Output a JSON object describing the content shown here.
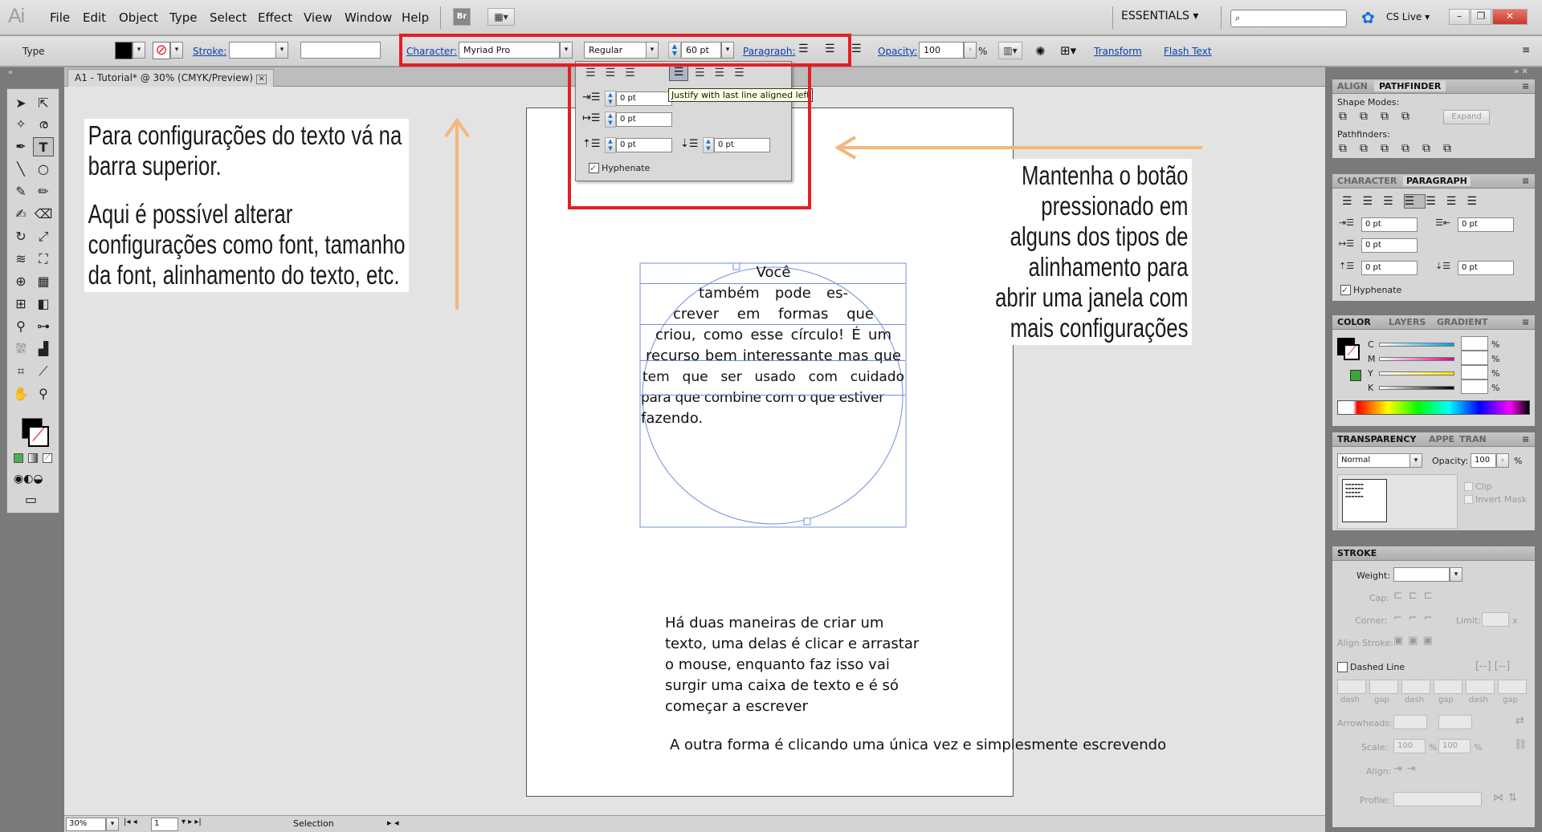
{
  "app": {
    "logo": "Ai",
    "workspace": "ESSENTIALS",
    "cslive": "CS Live",
    "bridge": "Br"
  },
  "menu": [
    "File",
    "Edit",
    "Object",
    "Type",
    "Select",
    "Effect",
    "View",
    "Window",
    "Help"
  ],
  "control": {
    "tool_label": "Type",
    "stroke_label": "Stroke:",
    "character_label": "Character:",
    "font_family": "Myriad Pro",
    "font_style": "Regular",
    "font_size": "60 pt",
    "paragraph_label": "Paragraph:",
    "opacity_label": "Opacity:",
    "opacity_value": "100",
    "opacity_unit": "%",
    "transform_label": "Transform",
    "flash_text_label": "Flash Text"
  },
  "doc_tab": "A1 - Tutorial* @ 30% (CMYK/Preview)",
  "popup": {
    "tooltip": "Justify with last line aligned left",
    "indent_left": "0 pt",
    "indent_first": "0 pt",
    "space_before": "0 pt",
    "space_after": "0 pt",
    "hyphenate": "Hyphenate"
  },
  "annotations": {
    "left_1": "Para configurações do texto vá na",
    "left_2": "barra superior.",
    "left_3": "Aqui é possível alterar",
    "left_4": "configurações como font, tamanho",
    "left_5": "da font, alinhamento do texto, etc.",
    "right_1": "Mantenha o botão",
    "right_2": "pressionado em",
    "right_3": "alguns dos tipos de",
    "right_4": "alinhamento para",
    "right_5": "abrir uma janela com",
    "right_6": "mais configurações"
  },
  "artboard": {
    "circle_lines": [
      "Você",
      "também pode es-",
      "crever em formas que",
      "criou, como esse círculo! É um",
      "recurso bem interessante mas que",
      "tem que ser usado com cuidado",
      "para que combine com o que estiver",
      "fazendo."
    ],
    "para1": [
      "Há duas maneiras de criar um",
      "texto, uma delas é clicar e arrastar",
      "o mouse, enquanto faz isso vai",
      "surgir uma caixa de texto e é só",
      "começar a escrever"
    ],
    "para2": "A outra forma é clicando uma única vez e simplesmente escrevendo"
  },
  "status": {
    "zoom": "30%",
    "page": "1",
    "tool": "Selection"
  },
  "panels": {
    "align_tab": "ALIGN",
    "pathfinder_tab": "PATHFINDER",
    "shape_modes": "Shape Modes:",
    "expand": "Expand",
    "pathfinders": "Pathfinders:",
    "character_tab": "CHARACTER",
    "paragraph_tab": "PARAGRAPH",
    "p_left": "0 pt",
    "p_right": "0 pt",
    "p_first": "0 pt",
    "p_before": "0 pt",
    "p_after": "0 pt",
    "hyphenate": "Hyphenate",
    "color_tab": "COLOR",
    "layers_tab": "LAYERS",
    "gradient_tab": "GRADIENT",
    "c": "C",
    "m": "M",
    "y": "Y",
    "k": "K",
    "pct": "%",
    "transparency_tab": "TRANSPARENCY",
    "appe_tab": "APPE",
    "tran_tab": "TRAN",
    "blend": "Normal",
    "opacity_label": "Opacity:",
    "opacity_value": "100",
    "clip": "Clip",
    "invert_mask": "Invert Mask",
    "stroke_tab": "STROKE",
    "weight": "Weight:",
    "cap": "Cap:",
    "corner": "Corner:",
    "limit": "Limit:",
    "limit_x": "x",
    "align_stroke": "Align Stroke:",
    "dashed_line": "Dashed Line",
    "dash": "dash",
    "gap": "gap",
    "arrowheads": "Arrowheads:",
    "scale": "Scale:",
    "scale_v1": "100",
    "scale_v2": "100",
    "align": "Align:",
    "profile": "Profile:"
  },
  "colors": {
    "red_box": "#e41e26",
    "arrow": "#f3b67c",
    "link": "#0a3fae",
    "bbox": "#6f8fd8"
  }
}
